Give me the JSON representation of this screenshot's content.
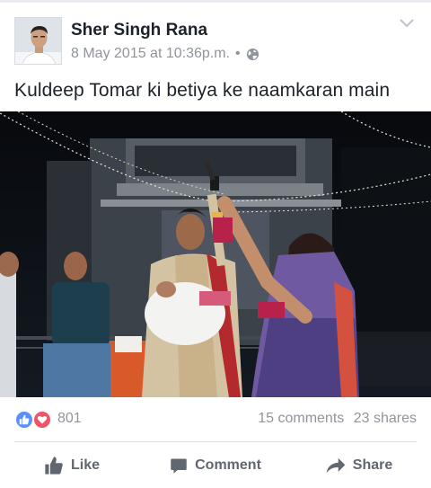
{
  "post": {
    "author_name": "Sher Singh Rana",
    "timestamp": "8 May 2015 at 10:36p.m.",
    "meta_separator": "•",
    "privacy_icon": "globe-icon",
    "options_icon": "chevron-down-icon",
    "caption": "Kuldeep Tomar ki betiya ke naamkaran main"
  },
  "stats": {
    "reactions": [
      "like-reaction-icon",
      "love-reaction-icon"
    ],
    "reaction_count": "801",
    "comments": "15 comments",
    "shares": "23 shares"
  },
  "actions": {
    "like_label": "Like",
    "comment_label": "Comment",
    "share_label": "Share"
  },
  "colors": {
    "like_blue": "#5890ff",
    "love_red": "#f25268",
    "meta_gray": "#90949c",
    "action_gray": "#606770"
  }
}
